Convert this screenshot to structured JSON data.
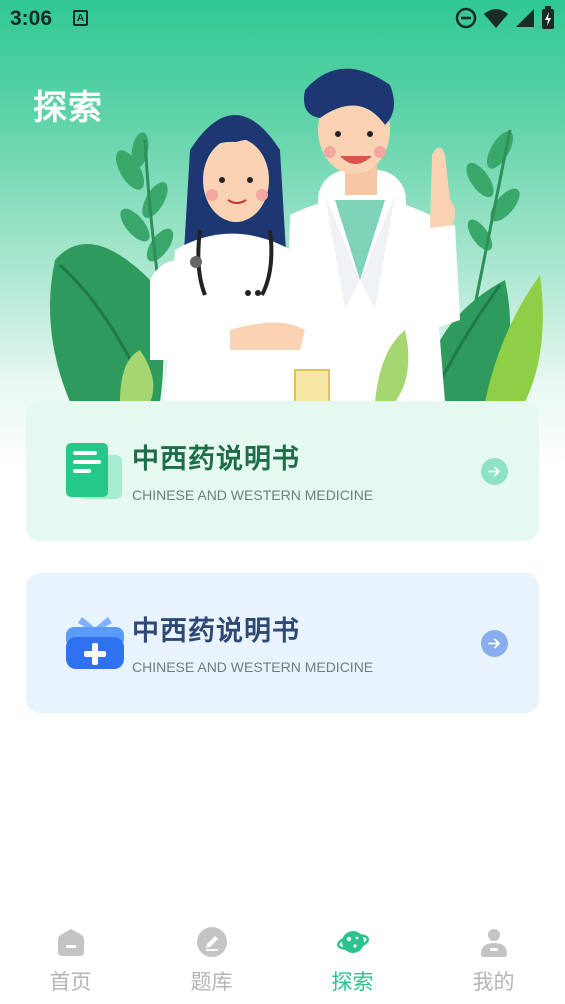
{
  "status_bar": {
    "time": "3:06",
    "notification_icon": "A"
  },
  "page": {
    "title": "探索"
  },
  "cards": [
    {
      "title": "中西药说明书",
      "subtitle": "CHINESE AND WESTERN MEDICINE",
      "icon": "document-icon",
      "accent": "#2ecc8e"
    },
    {
      "title": "中西药说明书",
      "subtitle": "CHINESE AND WESTERN MEDICINE",
      "icon": "medical-kit-icon",
      "accent": "#3d7ff0"
    }
  ],
  "tabbar": {
    "active_color": "#2bc38c",
    "inactive_color": "#b4b4b4",
    "tabs": [
      {
        "label": "首页",
        "icon": "home-icon"
      },
      {
        "label": "题库",
        "icon": "pencil-icon"
      },
      {
        "label": "探索",
        "icon": "planet-icon",
        "active": true
      },
      {
        "label": "我的",
        "icon": "person-icon"
      }
    ]
  }
}
